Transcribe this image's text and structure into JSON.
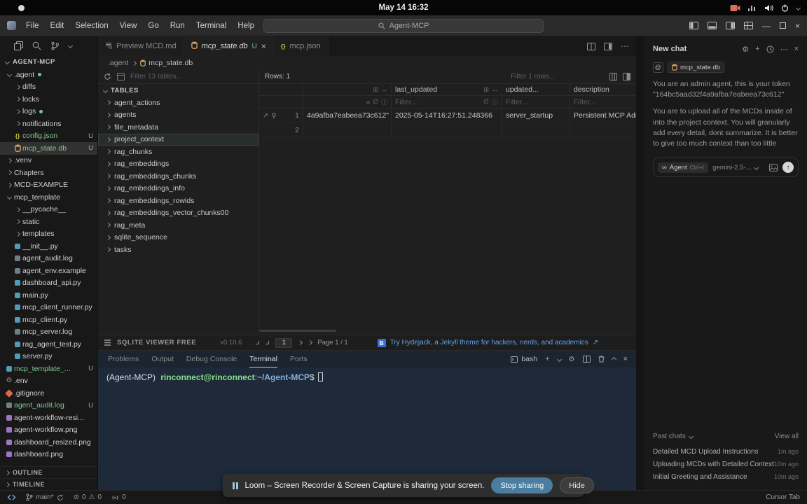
{
  "colors": {
    "accent_blue": "#5ea3e8",
    "untracked_green": "#73c991",
    "stop_sharing_blue": "#4a7da0",
    "terminal_bg": "#1e2a3a"
  },
  "system_bar": {
    "clock": "May 14 16:32"
  },
  "title_bar": {
    "menus": [
      "File",
      "Edit",
      "Selection",
      "View",
      "Go",
      "Run",
      "Terminal",
      "Help"
    ],
    "search_value": "Agent-MCP"
  },
  "explorer": {
    "section": "AGENT-MCP",
    "items": [
      {
        "label": ".agent",
        "indent": 0,
        "type": "folder",
        "expanded": true,
        "dot": true
      },
      {
        "label": "diffs",
        "indent": 1,
        "type": "folder"
      },
      {
        "label": "locks",
        "indent": 1,
        "type": "folder"
      },
      {
        "label": "logs",
        "indent": 1,
        "type": "folder",
        "dot": true
      },
      {
        "label": "notifications",
        "indent": 1,
        "type": "folder"
      },
      {
        "label": "config.json",
        "indent": 1,
        "type": "json",
        "badge": "U",
        "green": true
      },
      {
        "label": "mcp_state.db",
        "indent": 1,
        "type": "db",
        "badge": "U",
        "green": true,
        "selected": true
      },
      {
        "label": ".venv",
        "indent": 0,
        "type": "folder"
      },
      {
        "label": "Chapters",
        "indent": 0,
        "type": "folder"
      },
      {
        "label": "MCD-EXAMPLE",
        "indent": 0,
        "type": "folder"
      },
      {
        "label": "mcp_template",
        "indent": 0,
        "type": "folder",
        "expanded": true
      },
      {
        "label": "__pycache__",
        "indent": 1,
        "type": "folder"
      },
      {
        "label": "static",
        "indent": 1,
        "type": "folder"
      },
      {
        "label": "templates",
        "indent": 1,
        "type": "folder"
      },
      {
        "label": "__init__.py",
        "indent": 1,
        "type": "py"
      },
      {
        "label": "agent_audit.log",
        "indent": 1,
        "type": "file"
      },
      {
        "label": "agent_env.example",
        "indent": 1,
        "type": "file"
      },
      {
        "label": "dashboard_api.py",
        "indent": 1,
        "type": "py"
      },
      {
        "label": "main.py",
        "indent": 1,
        "type": "py"
      },
      {
        "label": "mcp_client_runner.py",
        "indent": 1,
        "type": "py"
      },
      {
        "label": "mcp_client.py",
        "indent": 1,
        "type": "py"
      },
      {
        "label": "mcp_server.log",
        "indent": 1,
        "type": "file"
      },
      {
        "label": "rag_agent_test.py",
        "indent": 1,
        "type": "py"
      },
      {
        "label": "server.py",
        "indent": 1,
        "type": "py"
      },
      {
        "label": "mcp_template_...",
        "indent": 0,
        "type": "py",
        "badge": "U",
        "green": true
      },
      {
        "label": ".env",
        "indent": 0,
        "type": "gear"
      },
      {
        "label": ".gitignore",
        "indent": 0,
        "type": "git"
      },
      {
        "label": "agent_audit.log",
        "indent": 0,
        "type": "file",
        "badge": "U",
        "green": true
      },
      {
        "label": "agent-workflow-resi...",
        "indent": 0,
        "type": "img"
      },
      {
        "label": "agent-workflow.png",
        "indent": 0,
        "type": "img"
      },
      {
        "label": "dashboard_resized.png",
        "indent": 0,
        "type": "img"
      },
      {
        "label": "dashboard.png",
        "indent": 0,
        "type": "img"
      }
    ],
    "bottom_sections": [
      "OUTLINE",
      "TIMELINE"
    ]
  },
  "editor": {
    "tabs": [
      {
        "label": "Preview MCD.md",
        "icon": "preview"
      },
      {
        "label": "mcp_state.db",
        "icon": "db",
        "active": true,
        "badge": "U"
      },
      {
        "label": "mcp.json",
        "icon": "json"
      }
    ],
    "breadcrumb": {
      "folder": ".agent",
      "file": "mcp_state.db"
    }
  },
  "sqlite": {
    "tables_filter_placeholder": "Filter 13 tables...",
    "rows_label": "Rows: 1",
    "rows_filter_placeholder": "Filter 1 rows...",
    "tables_header": "TABLES",
    "selected_table": "project_context",
    "tables": [
      "agent_actions",
      "agents",
      "file_metadata",
      "project_context",
      "rag_chunks",
      "rag_embeddings",
      "rag_embeddings_chunks",
      "rag_embeddings_info",
      "rag_embeddings_rowids",
      "rag_embeddings_vector_chunks00",
      "rag_meta",
      "sqlite_sequence",
      "tasks"
    ],
    "grid": {
      "columns": [
        "",
        "last_updated",
        "updated...",
        "description"
      ],
      "filter_placeholder": "Filter...",
      "rows": [
        {
          "num": "1",
          "icons": true,
          "cells": [
            "4a9afba7eabeea73c612\"",
            "2025-05-14T16:27:51.248366",
            "server_startup",
            "Persistent MCP Adm"
          ]
        },
        {
          "num": "2",
          "cells": [
            "",
            "",
            "",
            ""
          ]
        }
      ]
    },
    "footer": {
      "brand": "SQLITE VIEWER FREE",
      "version": "v0.10.6",
      "page_value": "1",
      "page_label": "Page 1 / 1",
      "promo_badge": "B",
      "promo": "Try Hydejack, a Jekyll theme for hackers, nerds, and academics",
      "promo_arrow": "↗"
    }
  },
  "panel": {
    "tabs": [
      {
        "label": "Problems"
      },
      {
        "label": "Output"
      },
      {
        "label": "Debug Console"
      },
      {
        "label": "Terminal",
        "active": true
      },
      {
        "label": "Ports"
      }
    ],
    "shell_label": "bash",
    "prompt": {
      "venv": "(Agent-MCP)",
      "user_host": "rinconnect@rinconnect",
      "colon": ":",
      "path": "~/Agent-MCP",
      "dollar": "$"
    }
  },
  "chat": {
    "title": "New chat",
    "at_symbol": "@",
    "context_chip": "mcp_state.db",
    "message_1": "You are an admin agent, this is your token \"164bc5aad32f4a9afba7eabeea73c612\"",
    "message_2": "You are to upload all of the MCDs inside of into the project context. You will granularly add every detail, dont summarize. It is better to give too much context than too little",
    "agent_mode": "Agent",
    "agent_shortcut": "Ctrl+I",
    "model": "gemini-2.5-...",
    "past_chats_label": "Past chats",
    "view_all_label": "View all",
    "history": [
      {
        "title": "Detailed MCD Upload Instructions",
        "time": "1m ago"
      },
      {
        "title": "Uploading MCDs with Detailed Context",
        "time": "10m ago"
      },
      {
        "title": "Initial Greeting and Assistance",
        "time": "10m ago"
      }
    ]
  },
  "status_bar": {
    "branch": "main*",
    "errors": "0",
    "warnings": "0",
    "broadcast": "0",
    "right_label": "Cursor Tab"
  },
  "loom": {
    "text": "Loom – Screen Recorder & Screen Capture is sharing your screen.",
    "stop_button": "Stop sharing",
    "hide_button": "Hide"
  }
}
